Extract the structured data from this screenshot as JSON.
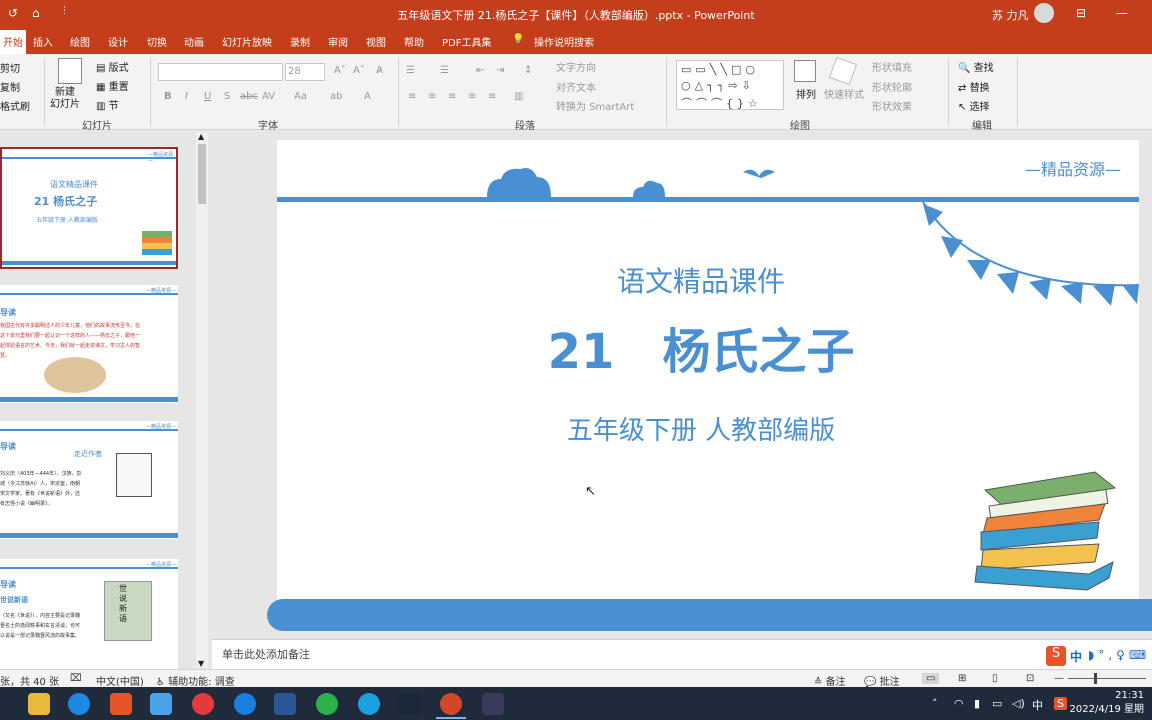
{
  "titlebar": {
    "title": "五年级语文下册  21.杨氏之子【课件】（人教部编版）.pptx - PowerPoint",
    "user": "苏 力凡"
  },
  "tabs": [
    "开始",
    "插入",
    "绘图",
    "设计",
    "切换",
    "动画",
    "幻灯片放映",
    "录制",
    "审阅",
    "视图",
    "帮助",
    "PDF工具集",
    "操作说明搜索"
  ],
  "ribbon": {
    "clipboard": {
      "cut": "剪切",
      "copy": "复制",
      "painter": "格式刷"
    },
    "slides": {
      "new_slide": "新建\n幻灯片",
      "layout": "版式",
      "reset": "重置",
      "section": "节",
      "label": "幻灯片"
    },
    "font": {
      "size": "28",
      "label": "字体"
    },
    "paragraph": {
      "text_dir": "文字方向",
      "align_text": "对齐文本",
      "smartart": "转换为 SmartArt",
      "label": "段落"
    },
    "drawing": {
      "arrange": "排列",
      "quick_styles": "快速样式",
      "fill": "形状填充",
      "outline": "形状轮廓",
      "effect": "形状效果",
      "label": "绘图"
    },
    "editing": {
      "find": "查找",
      "replace": "替换",
      "select": "选择",
      "label": "编辑"
    }
  },
  "thumbnails": [
    {
      "title": "语文精品课件",
      "heading": "21  杨氏之子",
      "sub": "五年级下册 人教部编版",
      "corner": "—精品资源—"
    },
    {
      "title": "导读",
      "corner": "—精品资源—",
      "text": "我国古代有许多聪明过人的少年儿童，他们的故事流传至今。在这个单元里我们要一起认识一个这样的人——杨氏之子，跟他一起体验语言的艺术。今天，我们就一起走进课文，学习古人的智慧。"
    },
    {
      "title": "导读",
      "sub": "走近作者",
      "corner": "—精品资源—",
      "text": "刘义庆（403年—444年），汉族，彭城（今江苏徐州）人，宋宗室，南朝宋文学家。著有《世说新语》外，还有志怪小说《幽明录》。"
    },
    {
      "title": "导读",
      "sub": "世说新语",
      "corner": "—精品资源—",
      "text": "（又名《世说》），内容主要是记录魏晋名士的逸闻轶事和玄言清谈，也可以说是一部记录魏晋风流的故事集。",
      "book": "世说新语"
    }
  ],
  "slide": {
    "corner": "—精品资源—",
    "subtitle": "语文精品课件",
    "title": "21　杨氏之子",
    "grade": "五年级下册 人教部编版"
  },
  "notes": "单击此处添加备注",
  "status": {
    "count": "张，共 40 张",
    "lang": "中文(中国)",
    "accessibility": "辅助功能: 调查",
    "notes_btn": "备注",
    "comments_btn": "批注"
  },
  "ime": {
    "mode": "中"
  },
  "clock": {
    "time": "21:31",
    "date": "2022/4/19 星期"
  },
  "colors": {
    "accent": "#c43e1c",
    "slide_blue": "#4a8fd1",
    "taskbar": "#1f2a3a"
  }
}
